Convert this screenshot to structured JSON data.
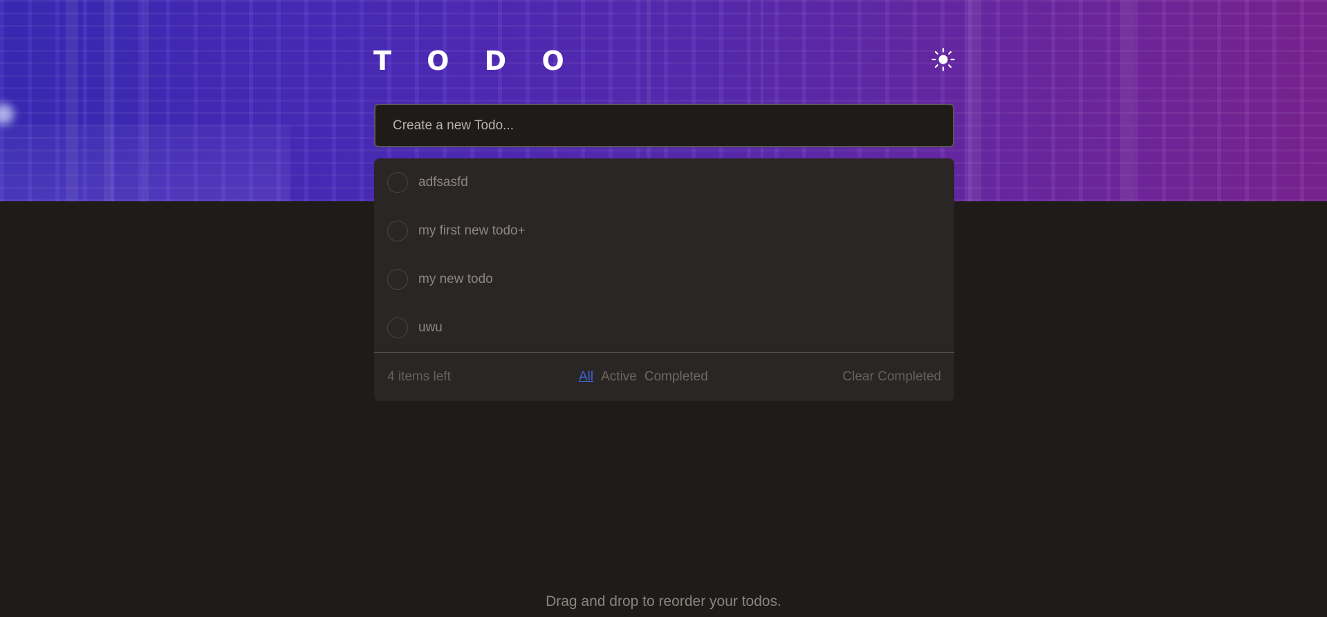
{
  "header": {
    "title": "T O D O",
    "theme_toggle_icon": "sun-icon"
  },
  "new_todo": {
    "placeholder": "Create a new Todo..."
  },
  "todos": [
    {
      "text": "adfsasfd",
      "completed": false
    },
    {
      "text": "my first new todo+",
      "completed": false
    },
    {
      "text": "my new todo",
      "completed": false
    },
    {
      "text": "uwu",
      "completed": false
    }
  ],
  "footer": {
    "items_left": "4 items left",
    "filters": [
      "All",
      "Active",
      "Completed"
    ],
    "active_filter": "All",
    "clear_label": "Clear Completed"
  },
  "hint": "Drag and drop to reorder your todos.",
  "colors": {
    "background": "#1e1b19",
    "card": "#2a2625",
    "accent": "#3d63d8",
    "hero_left": "#3a2ab8",
    "hero_right": "#7c2494"
  }
}
